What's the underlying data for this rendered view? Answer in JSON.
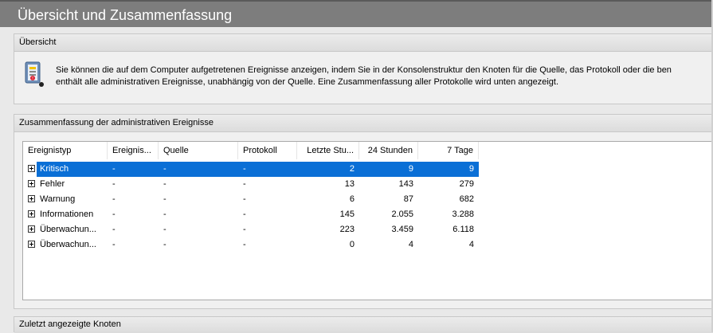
{
  "window": {
    "title": "Übersicht und Zusammenfassung"
  },
  "overview": {
    "header": "Übersicht",
    "icon": "event-viewer-icon",
    "text_line1": "Sie können die auf dem Computer aufgetretenen Ereignisse anzeigen, indem Sie in der Konsolenstruktur den Knoten für die Quelle, das Protokoll oder die ben",
    "text_line2": "enthält alle administrativen Ereignisse, unabhängig von der Quelle. Eine Zusammenfassung aller Protokolle wird unten angezeigt."
  },
  "summary": {
    "header": "Zusammenfassung der administrativen Ereignisse",
    "columns": [
      "Ereignistyp",
      "Ereignis...",
      "Quelle",
      "Protokoll",
      "Letzte Stu...",
      "24 Stunden",
      "7 Tage"
    ],
    "rows": [
      {
        "type": "Kritisch",
        "id": "-",
        "source": "-",
        "log": "-",
        "last_hour": "2",
        "h24": "9",
        "d7": "9",
        "selected": true
      },
      {
        "type": "Fehler",
        "id": "-",
        "source": "-",
        "log": "-",
        "last_hour": "13",
        "h24": "143",
        "d7": "279"
      },
      {
        "type": "Warnung",
        "id": "-",
        "source": "-",
        "log": "-",
        "last_hour": "6",
        "h24": "87",
        "d7": "682"
      },
      {
        "type": "Informationen",
        "id": "-",
        "source": "-",
        "log": "-",
        "last_hour": "145",
        "h24": "2.055",
        "d7": "3.288"
      },
      {
        "type": "Überwachun...",
        "id": "-",
        "source": "-",
        "log": "-",
        "last_hour": "223",
        "h24": "3.459",
        "d7": "6.118"
      },
      {
        "type": "Überwachun...",
        "id": "-",
        "source": "-",
        "log": "-",
        "last_hour": "0",
        "h24": "4",
        "d7": "4"
      }
    ]
  },
  "recent": {
    "header": "Zuletzt angezeigte Knoten"
  },
  "colors": {
    "title_bar": "#7d7d7d",
    "selection": "#0a6fd6"
  }
}
